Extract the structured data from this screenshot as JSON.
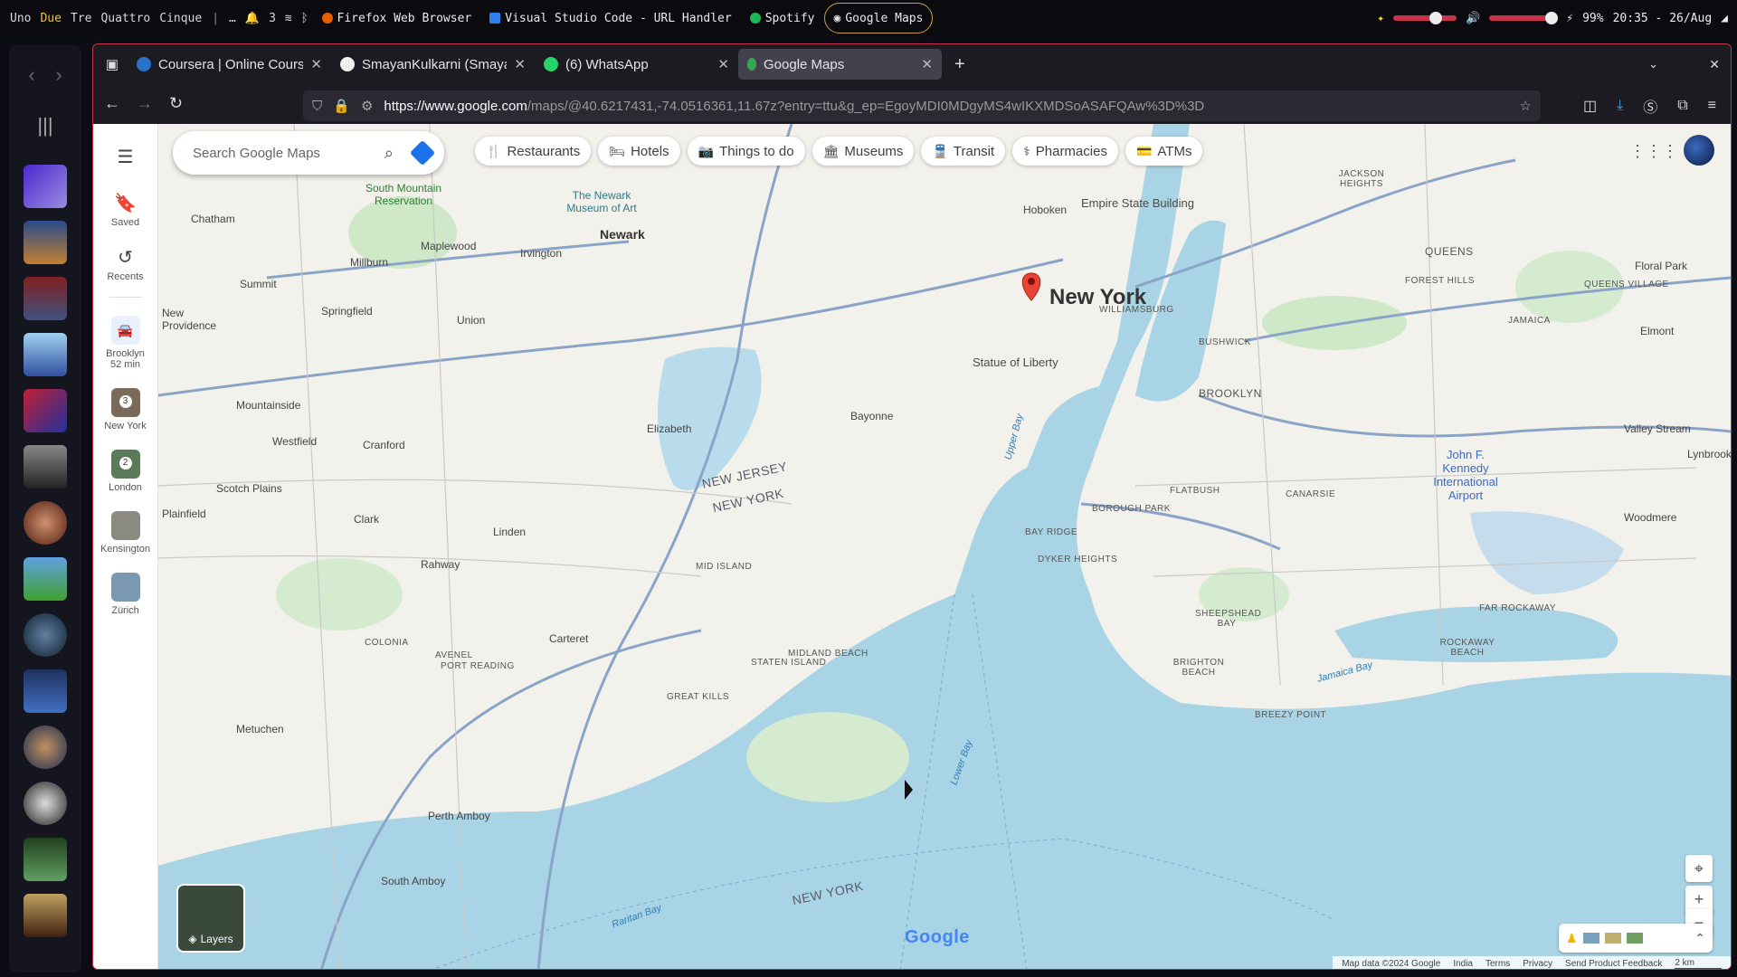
{
  "topbar": {
    "workspaces": [
      "Uno",
      "Due",
      "Tre",
      "Quattro",
      "Cinque"
    ],
    "active_workspace": "Due",
    "ellipsis": "…",
    "notif_count": "3",
    "apps": [
      {
        "label": "Firefox Web Browser",
        "color": "#e66000"
      },
      {
        "label": "Visual Studio Code - URL Handler",
        "color": "#2f80ed"
      },
      {
        "label": "Spotify",
        "color": "#1db954"
      }
    ],
    "focused_app": "Google Maps",
    "battery": "99%",
    "clock": "20:35 - 26/Aug"
  },
  "browser": {
    "tabs": [
      {
        "label": "Coursera | Online Courses",
        "icon": "coursera-icon",
        "color": "#2a73cc"
      },
      {
        "label": "SmayanKulkarni (Smayan",
        "icon": "github-icon",
        "color": "#eeeeee"
      },
      {
        "label": "(6) WhatsApp",
        "icon": "whatsapp-icon",
        "color": "#25d366"
      },
      {
        "label": "Google Maps",
        "icon": "maps-pin-icon",
        "color": "#34a853"
      }
    ],
    "url_host": "https://www.google.com",
    "url_rest": "/maps/@40.6217431,-74.0516361,11.67z?entry=ttu&g_ep=EgoyMDI0MDgyMS4wIKXMDSoASAFQAw%3D%3D"
  },
  "maps": {
    "rail": {
      "saved": "Saved",
      "recents": "Recents",
      "recent_places": [
        {
          "label": "Brooklyn",
          "sub": "52 min"
        },
        {
          "label": "New York",
          "count": "3"
        },
        {
          "label": "London",
          "count": "2"
        },
        {
          "label": "Kensington"
        },
        {
          "label": "Zürich"
        }
      ]
    },
    "search_placeholder": "Search Google Maps",
    "chips": [
      "Restaurants",
      "Hotels",
      "Things to do",
      "Museums",
      "Transit",
      "Pharmacies",
      "ATMs"
    ],
    "focus_city": "New York",
    "places": {
      "newark": "Newark",
      "queens": "QUEENS",
      "brooklyn": "BROOKLYN",
      "statue": "Statue of Liberty",
      "empire": "Empire State Building",
      "jfk": "John F. Kennedy International Airport",
      "nj": "NEW JERSEY",
      "ny": "NEW YORK",
      "ny2": "NEW YORK",
      "staten": "STATEN ISLAND",
      "bayonne": "Bayonne",
      "elizabeth": "Elizabeth",
      "hoboken": "Hoboken",
      "williamsburg": "WILLIAMSBURG",
      "bushwick": "BUSHWICK",
      "flatbush": "FLATBUSH",
      "canarsie": "CANARSIE",
      "borough_park": "BOROUGH PARK",
      "bay_ridge": "BAY RIDGE",
      "dyker": "DYKER HEIGHTS",
      "sheepshead": "SHEEPSHEAD BAY",
      "brighton": "BRIGHTON BEACH",
      "breezy": "BREEZY POINT",
      "rockaway": "ROCKAWAY BEACH",
      "far_rockaway": "FAR ROCKAWAY",
      "jamaica": "JAMAICA",
      "forest_hills": "FOREST HILLS",
      "queens_village": "QUEENS VILLAGE",
      "jackson": "JACKSON HEIGHTS",
      "floral": "Floral Park",
      "elmont": "Elmont",
      "valley": "Valley Stream",
      "woodmere": "Woodmere",
      "lynbrook": "Lynbrook",
      "chatham": "Chatham",
      "summit": "Summit",
      "millburn": "Millburn",
      "maplewood": "Maplewood",
      "irvington": "Irvington",
      "springfield": "Springfield",
      "union": "Union",
      "mountainside": "Mountainside",
      "westfield": "Westfield",
      "cranford": "Cranford",
      "scotch": "Scotch Plains",
      "clark": "Clark",
      "linden": "Linden",
      "rahway": "Rahway",
      "colonia": "COLONIA",
      "avenel": "AVENEL",
      "carteret": "Carteret",
      "port_reading": "PORT READING",
      "metuchen": "Metuchen",
      "perth_amboy": "Perth Amboy",
      "south_amboy": "South Amboy",
      "great_kills": "GREAT KILLS",
      "midland": "MIDLAND BEACH",
      "mid_island": "MID ISLAND",
      "new_providence": "New Providence",
      "plainfield": "Plainfield",
      "south_mountain": "South Mountain Reservation",
      "newark_museum": "The Newark Museum of Art",
      "upper_bay": "Upper Bay",
      "lower_bay": "Lower Bay",
      "jamaica_bay": "Jamaica Bay",
      "raritan_bay": "Raritan Bay"
    },
    "layers": "Layers",
    "google": "Google",
    "attribution": [
      "Map data ©2024 Google",
      "India",
      "Terms",
      "Privacy",
      "Send Product Feedback",
      "2 km"
    ]
  }
}
